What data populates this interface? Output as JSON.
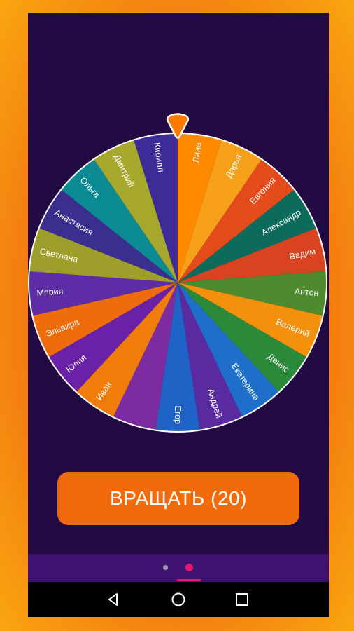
{
  "wheel": {
    "segments": [
      {
        "name": "Лина",
        "color": "#ff8a00"
      },
      {
        "name": "Дарья",
        "color": "#f7a11a"
      },
      {
        "name": "Евгения",
        "color": "#e34b1b"
      },
      {
        "name": "Александр",
        "color": "#0c6b5a"
      },
      {
        "name": "Вадим",
        "color": "#d9431f"
      },
      {
        "name": "Антон",
        "color": "#4e8b2e"
      },
      {
        "name": "Валерий",
        "color": "#f5900c"
      },
      {
        "name": "Денис",
        "color": "#2a8a3a"
      },
      {
        "name": "Екатерина",
        "color": "#1e6fc9"
      },
      {
        "name": "Андрей",
        "color": "#5a2ba0"
      },
      {
        "name": "Егор",
        "color": "#1f63c6"
      },
      {
        "name": "",
        "color": "#7d2ba0"
      },
      {
        "name": "Иван",
        "color": "#f07d0a"
      },
      {
        "name": "Юлия",
        "color": "#6b20a8"
      },
      {
        "name": "Эльвира",
        "color": "#ef6c0c"
      },
      {
        "name": "Мприя",
        "color": "#5e2ca5"
      },
      {
        "name": "Светлана",
        "color": "#9e9e2a"
      },
      {
        "name": "Анастасия",
        "color": "#3a2f8f"
      },
      {
        "name": "Ольга",
        "color": "#0b8a94"
      },
      {
        "name": "Дмитрий",
        "color": "#a6a82c"
      },
      {
        "name": "Кирилл",
        "color": "#3d2b97"
      }
    ],
    "pointer_color": "#ff7a00",
    "rim_color": "#ffffff"
  },
  "spin_button": {
    "label": "ВРАЩАТЬ (20)",
    "color": "#f26a0c"
  },
  "pager": {
    "page_count": 2,
    "active_page": 2
  },
  "navbar": {
    "icons": [
      "back-icon",
      "home-icon",
      "recents-icon"
    ]
  }
}
